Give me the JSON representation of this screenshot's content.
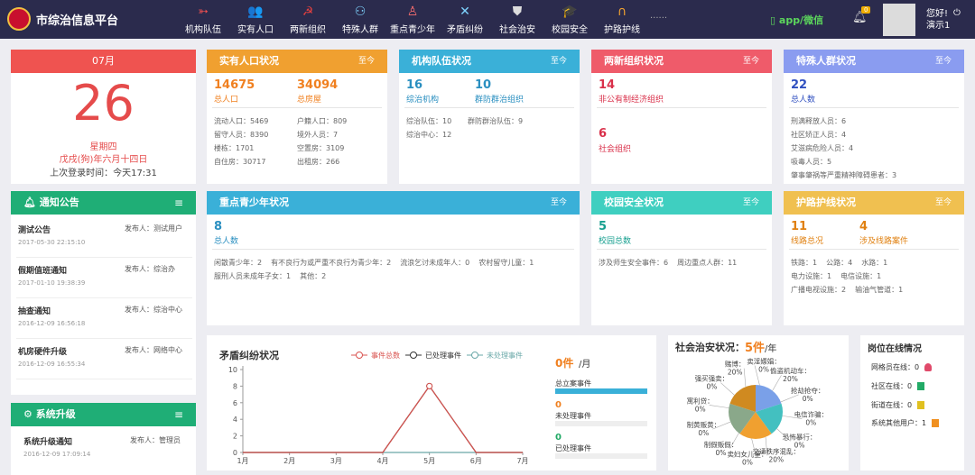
{
  "header": {
    "app_title": "市综治信息平台",
    "nav": [
      {
        "label": "机构队伍",
        "icon": "banner-icon",
        "glyph": "➳"
      },
      {
        "label": "实有人口",
        "icon": "people-icon",
        "glyph": "👥"
      },
      {
        "label": "两新组织",
        "icon": "party-emblem-icon",
        "glyph": "☭"
      },
      {
        "label": "特殊人群",
        "icon": "group-icon",
        "glyph": "⚇"
      },
      {
        "label": "重点青少年",
        "icon": "youth-icon",
        "glyph": "♙"
      },
      {
        "label": "矛盾纠纷",
        "icon": "conflict-icon",
        "glyph": "✕"
      },
      {
        "label": "社会治安",
        "icon": "police-badge-icon",
        "glyph": "⛊"
      },
      {
        "label": "校园安全",
        "icon": "graduation-cap-icon",
        "glyph": "🎓"
      },
      {
        "label": "护路护线",
        "icon": "arch-icon",
        "glyph": "∩"
      }
    ],
    "more": "......",
    "app_wechat": "app/微信",
    "notification_count": "0",
    "greeting": "您好!",
    "username": "演示1"
  },
  "calendar": {
    "month": "07月",
    "day": "26",
    "weekday": "星期四",
    "lunar": "戊戌(狗)年六月十四日",
    "last_login": "上次登录时间：今天17:31"
  },
  "population": {
    "title": "实有人口状况",
    "tag": "至今",
    "total_value": "14675",
    "total_label": "总人口",
    "houses_value": "34094",
    "houses_label": "总房屋",
    "details": [
      [
        "流动人口：5469",
        "户籍人口：809"
      ],
      [
        "留守人员：8390",
        "境外人员：7"
      ],
      [
        "楼栋：1701",
        "空置房：3109"
      ],
      [
        "自住房：30717",
        "出租房：266"
      ]
    ]
  },
  "organization": {
    "title": "机构队伍状况",
    "tag": "至今",
    "inst_value": "16",
    "inst_label": "综治机构",
    "team_value": "10",
    "team_label": "群防群治组织",
    "details": [
      [
        "综治队伍：10",
        "群防群治队伍：9"
      ],
      [
        "综治中心：12",
        ""
      ]
    ]
  },
  "two_new": {
    "title": "两新组织状况",
    "tag": "至今",
    "nonpub_value": "14",
    "nonpub_label": "非公有制经济组织",
    "social_value": "6",
    "social_label": "社会组织"
  },
  "special": {
    "title": "特殊人群状况",
    "tag": "至今",
    "total_value": "22",
    "total_label": "总人数",
    "details": [
      [
        "刑满释放人员：6",
        "社区矫正人员：4"
      ],
      [
        "艾滋病危险人员：4",
        "吸毒人员：5"
      ],
      [
        "肇事肇祸等严重精神障碍患者：3",
        ""
      ]
    ]
  },
  "notice": {
    "title": "通知公告",
    "items": [
      {
        "title": "测试公告",
        "publisher": "发布人：测试用户",
        "date": "2017-05-30 22:15:10"
      },
      {
        "title": "假期值班通知",
        "publisher": "发布人：综治办",
        "date": "2017-01-10 19:38:39"
      },
      {
        "title": "抽查通知",
        "publisher": "发布人：综治中心",
        "date": "2016-12-09 16:56:18"
      },
      {
        "title": "机房硬件升级",
        "publisher": "发布人：网络中心",
        "date": "2016-12-09 16:55:34"
      }
    ]
  },
  "upgrade": {
    "title": "系统升级",
    "items": [
      {
        "title": "系统升级通知",
        "publisher": "发布人：管理员",
        "date": "2016-12-09 17:09:14"
      }
    ]
  },
  "youth": {
    "title": "重点青少年状况",
    "tag": "至今",
    "total_value": "8",
    "total_label": "总人数",
    "details": [
      [
        "闲散青少年：2",
        "有不良行为或严重不良行为青少年：2",
        "流浪乞讨未成年人：0",
        "农村留守儿童：1"
      ],
      [
        "服刑人员未成年子女：1",
        "其他：2"
      ]
    ]
  },
  "campus": {
    "title": "校园安全状况",
    "tag": "至今",
    "total_value": "5",
    "total_label": "校园总数",
    "details": [
      [
        "涉及师生安全事件：6",
        "周边重点人群：11"
      ]
    ]
  },
  "road": {
    "title": "护路护线状况",
    "tag": "至今",
    "lines_value": "11",
    "lines_label": "线路总况",
    "cases_value": "4",
    "cases_label": "涉及线路案件",
    "details": [
      [
        "铁路：1",
        "公路：4",
        "水路：1"
      ],
      [
        "电力设施：1",
        "电信设施：1"
      ],
      [
        "广播电视设施：2",
        "输油气管道：1"
      ]
    ]
  },
  "dispute": {
    "title": "矛盾纠纷状况",
    "legend": [
      "事件总数",
      "已处理事件",
      "未处理事件"
    ],
    "per_month_value": "0件",
    "per_month_unit": "/月",
    "stats": [
      {
        "label": "总立案事件",
        "value": ""
      },
      {
        "label": "未处理事件",
        "value": "0"
      },
      {
        "label": "已处理事件",
        "value": "0"
      }
    ],
    "total_progress": 1.0
  },
  "chart_data": {
    "type": "line",
    "x": [
      "1月",
      "2月",
      "3月",
      "4月",
      "5月",
      "6月",
      "7月"
    ],
    "yticks": [
      0,
      2,
      4,
      6,
      8,
      10
    ],
    "ylim": [
      0,
      10
    ],
    "series": [
      {
        "name": "事件总数",
        "color": "#d9534f",
        "values": [
          0,
          0,
          0,
          0,
          8,
          0,
          0
        ]
      },
      {
        "name": "已处理事件",
        "color": "#333333",
        "values": [
          0,
          0,
          0,
          0,
          8,
          0,
          0
        ]
      },
      {
        "name": "未处理事件",
        "color": "#6aa8a8",
        "values": [
          0,
          0,
          0,
          0,
          0,
          0,
          0
        ]
      }
    ]
  },
  "security": {
    "title": "社会治安状况：",
    "count": "5件",
    "unit": "/年",
    "pie": {
      "type": "pie",
      "slices": [
        {
          "name": "交通秩序混乱：",
          "value": "20%",
          "color": "#f0a030"
        },
        {
          "name": "卖妇女儿童：",
          "value": "0%",
          "color": "#f0a030"
        },
        {
          "name": "制假贩假：",
          "value": "0%",
          "color": "#f0a030"
        },
        {
          "name": "制黄贩黄：",
          "value": "0%",
          "color": "#f0a030"
        },
        {
          "name": "寓利贷：",
          "value": "0%",
          "color": "#f0a030"
        },
        {
          "name": "强买强卖：",
          "value": "0%",
          "color": "#f0a030"
        },
        {
          "name": "赌博：",
          "value": "20%",
          "color": "#f0a030"
        },
        {
          "name": "卖淫嫖娼：",
          "value": "0%",
          "color": "#f0a030"
        },
        {
          "name": "偷盗机动车：",
          "value": "20%",
          "color": "#f0a030"
        },
        {
          "name": "抢劫抢夺：",
          "value": "0%",
          "color": "#f0a030"
        },
        {
          "name": "电信诈骗：",
          "value": "0%",
          "color": "#f0a030"
        },
        {
          "name": "恐怖暴行：",
          "value": "0%",
          "color": "#f0a030"
        }
      ],
      "colors": [
        "#7aa0e8",
        "#43c0c0",
        "#f0a030",
        "#8aa88a",
        "#d08a20"
      ]
    }
  },
  "online": {
    "title": "岗位在线情况",
    "rows": [
      {
        "label": "网格员在线：0",
        "icon": "person-icon",
        "color": "#e04a6a"
      },
      {
        "label": "社区在线：0",
        "icon": "chat-icon",
        "color": "#22aa66"
      },
      {
        "label": "街道在线：0",
        "icon": "phone-icon",
        "color": "#e0c020"
      },
      {
        "label": "系统其他用户：1",
        "icon": "users-icon",
        "color": "#f09020"
      }
    ]
  }
}
